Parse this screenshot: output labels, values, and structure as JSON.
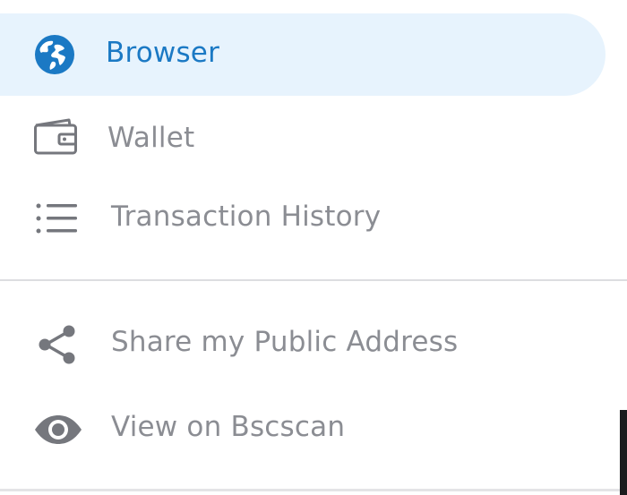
{
  "colors": {
    "accent": "#1b79c4",
    "active_background": "#e7f3fd",
    "text_muted": "#8b8d93",
    "icon_muted": "#75777d",
    "divider": "#dcdde0"
  },
  "nav": {
    "items": [
      {
        "label": "Browser",
        "icon": "globe-icon",
        "active": true
      },
      {
        "label": "Wallet",
        "icon": "wallet-icon",
        "active": false
      },
      {
        "label": "Transaction History",
        "icon": "list-icon",
        "active": false
      }
    ]
  },
  "actions": {
    "items": [
      {
        "label": "Share my Public Address",
        "icon": "share-icon"
      },
      {
        "label": "View on Bscscan",
        "icon": "eye-icon"
      }
    ]
  }
}
